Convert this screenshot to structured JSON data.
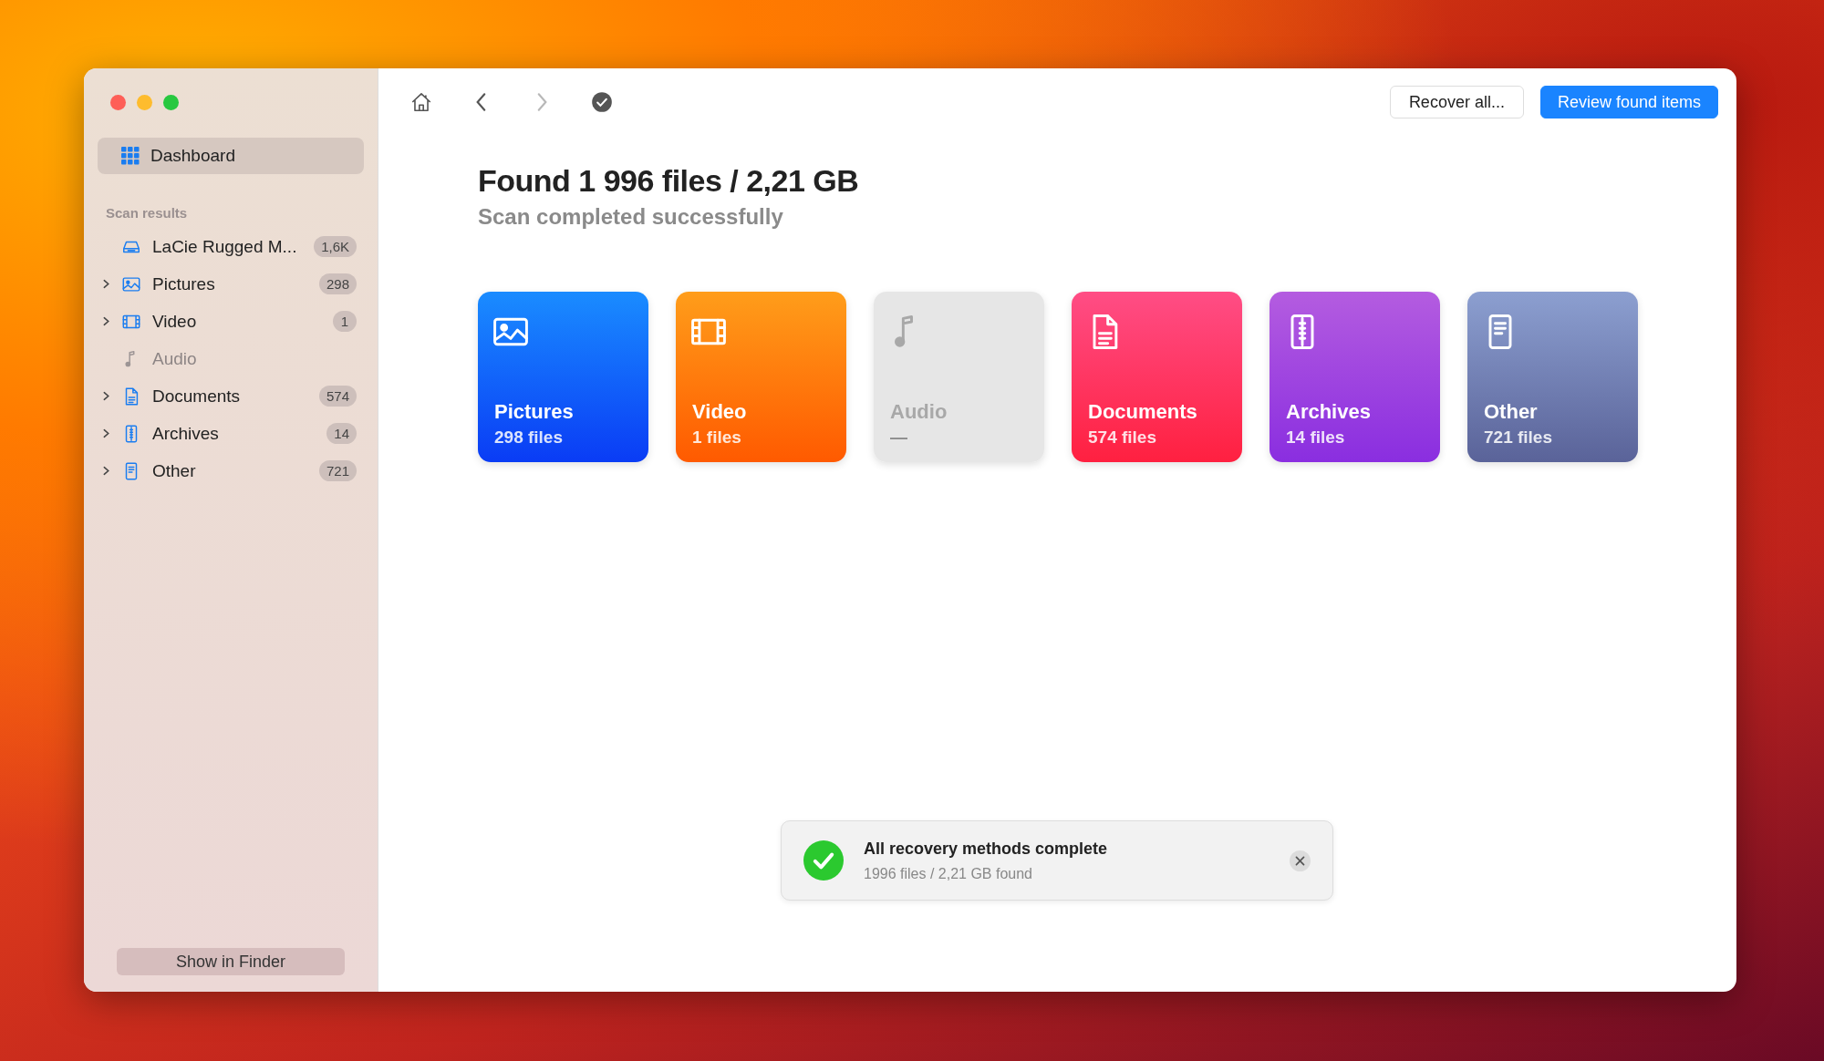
{
  "sidebar": {
    "dashboard": {
      "label": "Dashboard",
      "selected": true
    },
    "section_title": "Scan results",
    "items": [
      {
        "kind": "drive",
        "label": "LaCie Rugged M...",
        "count": "1,6K",
        "expandable": false,
        "disabled": false,
        "selected": false
      },
      {
        "kind": "pictures",
        "label": "Pictures",
        "count": "298",
        "expandable": true,
        "disabled": false,
        "selected": false
      },
      {
        "kind": "video",
        "label": "Video",
        "count": "1",
        "expandable": true,
        "disabled": false,
        "selected": false
      },
      {
        "kind": "audio",
        "label": "Audio",
        "expandable": false,
        "disabled": true,
        "selected": false
      },
      {
        "kind": "documents",
        "label": "Documents",
        "count": "574",
        "expandable": true,
        "disabled": false,
        "selected": false
      },
      {
        "kind": "archives",
        "label": "Archives",
        "count": "14",
        "expandable": true,
        "disabled": false,
        "selected": false
      },
      {
        "kind": "other",
        "label": "Other",
        "count": "721",
        "expandable": true,
        "disabled": false,
        "selected": false
      }
    ],
    "footer_button": "Show in Finder"
  },
  "toolbar": {
    "nav": [
      {
        "kind": "home",
        "disabled": false
      },
      {
        "kind": "back",
        "disabled": false
      },
      {
        "kind": "forward",
        "disabled": true
      },
      {
        "kind": "done",
        "disabled": false
      }
    ],
    "buttons": [
      {
        "kind": "secondary",
        "label": "Recover all..."
      },
      {
        "kind": "primary",
        "label": "Review found items"
      }
    ]
  },
  "summary": {
    "title": "Found 1 996 files / 2,21 GB",
    "subtitle": "Scan completed successfully"
  },
  "cards": [
    {
      "kind": "pictures",
      "label": "Pictures",
      "detail": "298 files",
      "disabled": false
    },
    {
      "kind": "video",
      "label": "Video",
      "detail": "1 files",
      "disabled": false
    },
    {
      "kind": "audio",
      "label": "Audio",
      "detail": "—",
      "disabled": true
    },
    {
      "kind": "documents",
      "label": "Documents",
      "detail": "574 files",
      "disabled": false
    },
    {
      "kind": "archives",
      "label": "Archives",
      "detail": "14 files",
      "disabled": false
    },
    {
      "kind": "other",
      "label": "Other",
      "detail": "721 files",
      "disabled": false
    }
  ],
  "toast": {
    "title": "All recovery methods complete",
    "detail": "1996 files / 2,21 GB found"
  }
}
